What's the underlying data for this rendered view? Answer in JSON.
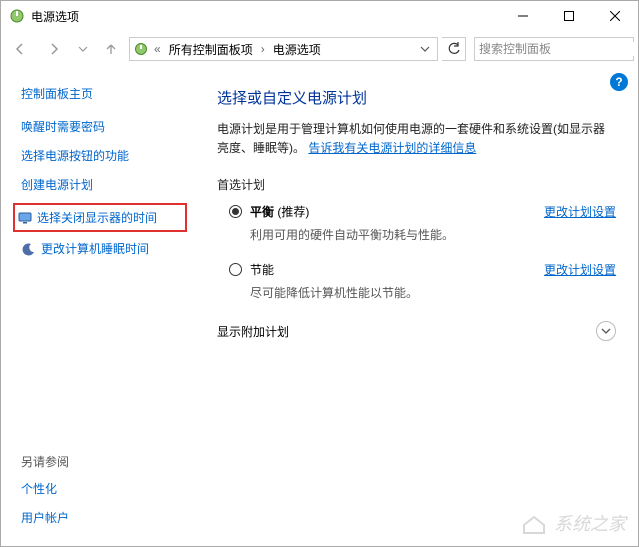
{
  "window": {
    "title": "电源选项"
  },
  "nav": {
    "breadcrumb": [
      "所有控制面板项",
      "电源选项"
    ],
    "search_placeholder": "搜索控制面板"
  },
  "sidebar": {
    "home": "控制面板主页",
    "links": [
      {
        "label": "唤醒时需要密码",
        "icon": false
      },
      {
        "label": "选择电源按钮的功能",
        "icon": false
      },
      {
        "label": "创建电源计划",
        "icon": false
      },
      {
        "label": "选择关闭显示器的时间",
        "icon": true,
        "highlighted": true
      },
      {
        "label": "更改计算机睡眠时间",
        "icon": true
      }
    ],
    "seealso_head": "另请参阅",
    "seealso": [
      "个性化",
      "用户帐户"
    ]
  },
  "main": {
    "title": "选择或自定义电源计划",
    "desc_prefix": "电源计划是用于管理计算机如何使用电源的一套硬件和系统设置(如显示器亮度、睡眠等)。",
    "desc_link": "告诉我有关电源计划的详细信息",
    "preferred_head": "首选计划",
    "plans": [
      {
        "name": "平衡",
        "suffix": " (推荐)",
        "checked": true,
        "desc": "利用可用的硬件自动平衡功耗与性能。",
        "change": "更改计划设置"
      },
      {
        "name": "节能",
        "suffix": "",
        "checked": false,
        "desc": "尽可能降低计算机性能以节能。",
        "change": "更改计划设置"
      }
    ],
    "additional_head": "显示附加计划"
  },
  "watermark": "系统之家"
}
